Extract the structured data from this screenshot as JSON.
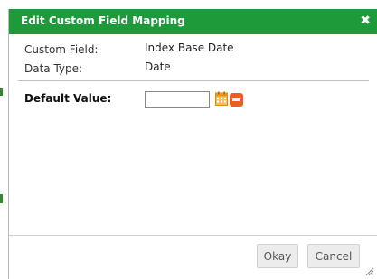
{
  "dialog": {
    "title": "Edit Custom Field Mapping",
    "close_symbol": "✖"
  },
  "fields": {
    "custom_field_label": "Custom Field:",
    "custom_field_value": "Index Base Date",
    "data_type_label": "Data Type:",
    "data_type_value": "Date"
  },
  "default_value": {
    "label": "Default Value:",
    "input_value": "",
    "calendar_icon": "calendar-icon",
    "clear_icon": "clear-icon"
  },
  "footer": {
    "okay_label": "Okay",
    "cancel_label": "Cancel"
  },
  "colors": {
    "titlebar": "#1f9a3b",
    "clear_button": "#ee5a24",
    "calendar": "#f0a020"
  }
}
